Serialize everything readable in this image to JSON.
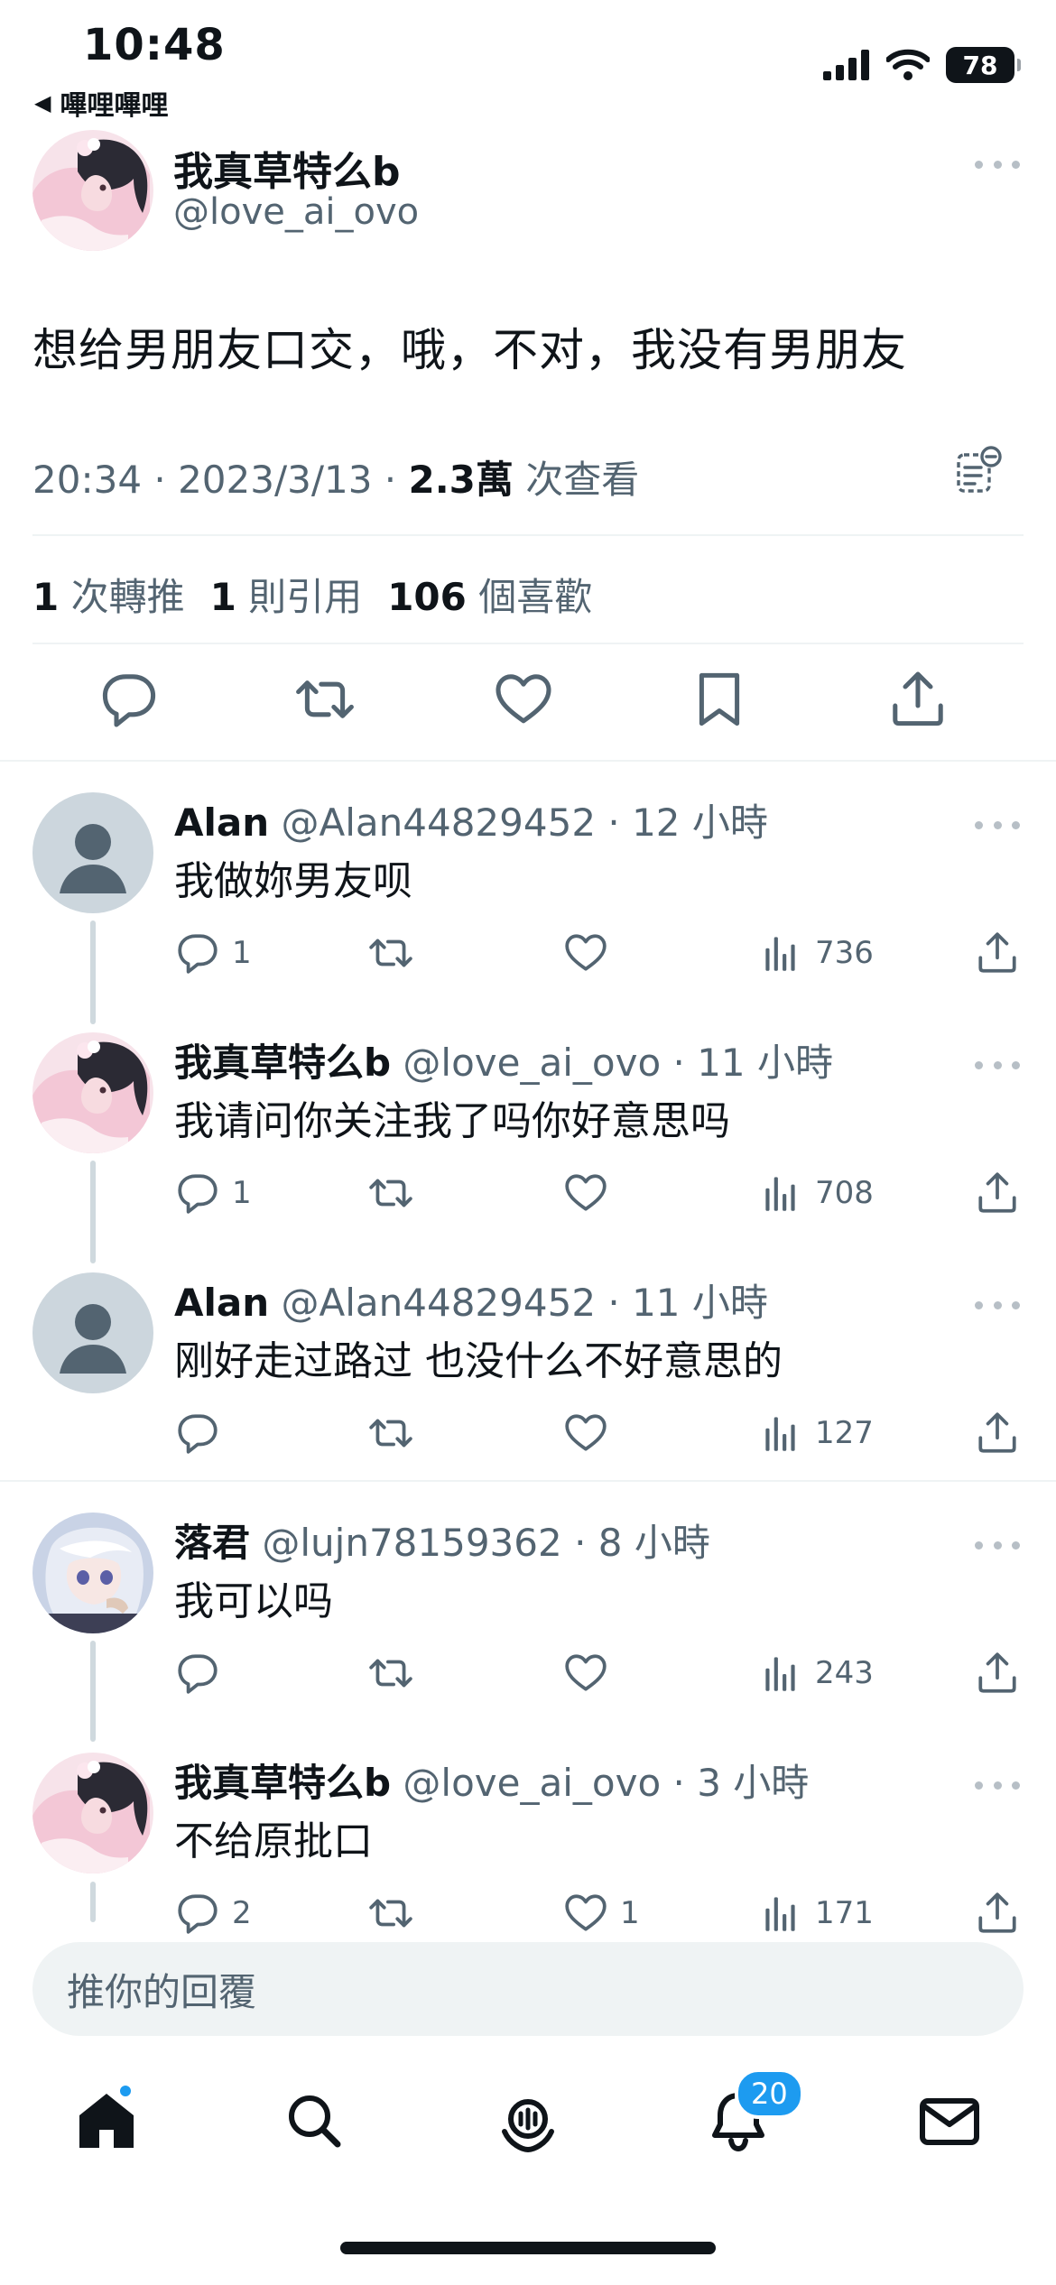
{
  "status_bar": {
    "time": "10:48",
    "back_label": "嗶哩嗶哩",
    "battery": "78",
    "icons": [
      "signal-icon",
      "wifi-icon",
      "battery-icon"
    ]
  },
  "main_tweet": {
    "name": "我真草特么b",
    "handle": "@love_ai_ovo",
    "text": "想给男朋友口交，哦，不对，我没有男朋友",
    "time_date": "20:34 · 2023/3/13 · ",
    "views_count": "2.3萬",
    "views_label": " 次查看",
    "retweets_count": "1",
    "retweets_label": " 次轉推",
    "quotes_count": "1",
    "quotes_label": " 則引用",
    "likes_count": "106",
    "likes_label": " 個喜歡"
  },
  "replies": [
    {
      "name": "Alan",
      "handle": " @Alan44829452 · 12 小時",
      "text": "我做妳男友呗",
      "reply_count": "1",
      "like_count": "",
      "views": "736",
      "avatar": "default"
    },
    {
      "name": "我真草特么b",
      "handle": " @love_ai_ovo · 11 小時",
      "text": "我请问你关注我了吗你好意思吗",
      "reply_count": "1",
      "like_count": "",
      "views": "708",
      "avatar": "anime-girl"
    },
    {
      "name": "Alan",
      "handle": " @Alan44829452 · 11 小時",
      "text": "刚好走过路过 也没什么不好意思的",
      "reply_count": "",
      "like_count": "",
      "views": "127",
      "avatar": "default"
    },
    {
      "name": "落君",
      "handle": " @lujn78159362 · 8 小時",
      "text": "我可以吗",
      "reply_count": "",
      "like_count": "",
      "views": "243",
      "avatar": "anime-silver"
    },
    {
      "name": "我真草特么b",
      "handle": " @love_ai_ovo · 3 小時",
      "text": "不给原批口",
      "reply_count": "2",
      "like_count": "1",
      "views": "171",
      "avatar": "anime-girl"
    }
  ],
  "composer": {
    "placeholder": "推你的回覆"
  },
  "bottom_nav": {
    "notifications_badge": "20",
    "items": [
      "home-icon",
      "search-icon",
      "spaces-icon",
      "notifications-icon",
      "messages-icon"
    ]
  },
  "colors": {
    "text_primary": "#0f1419",
    "text_secondary": "#536471",
    "accent": "#1d9bf0",
    "divider": "#eff3f4"
  }
}
